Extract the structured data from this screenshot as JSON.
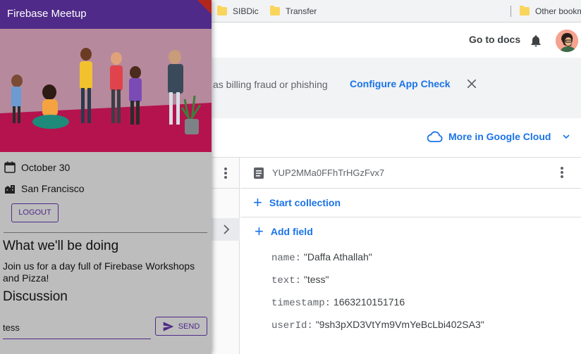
{
  "bookmarks": [
    {
      "label": "SIBDic"
    },
    {
      "label": "Transfer"
    },
    {
      "label": "Other bookmarks"
    }
  ],
  "header": {
    "go_to_docs": "Go to docs"
  },
  "banner": {
    "text": "as billing fraud or phishing",
    "configure_link": "Configure App Check"
  },
  "cloud": {
    "more_in_cloud": "More in Google Cloud"
  },
  "document": {
    "id": "YUP2MMa0FFhTrHGzFvx7",
    "start_collection": "Start collection",
    "add_field": "Add field",
    "fields": [
      {
        "key": "name:",
        "value": "\"Daffa Athallah\""
      },
      {
        "key": "text:",
        "value": "\"tess\""
      },
      {
        "key": "timestamp:",
        "value": "1663210151716"
      },
      {
        "key": "userId:",
        "value": "\"9sh3pXD3VtYm9VmYeBcLbi402SA3\""
      }
    ]
  },
  "app": {
    "title": "Firebase Meetup",
    "date": "October 30",
    "location": "San Francisco",
    "logout_label": "LOGOUT",
    "heading": "What we'll be doing",
    "description": "Join us for a day full of Firebase Workshops and Pizza!",
    "discussion_heading": "Discussion",
    "message_value": "tess",
    "send_label": "SEND"
  },
  "colors": {
    "app_primary": "#4f2a88",
    "console_link": "#1a73e8",
    "hero_top": "#b6899d",
    "hero_floor": "#b5134d"
  }
}
